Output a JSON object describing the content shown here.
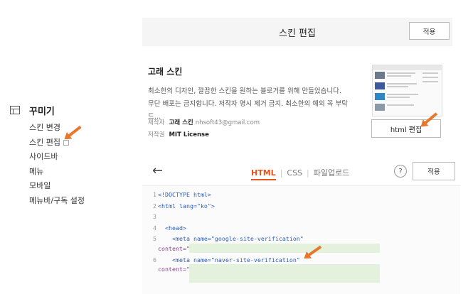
{
  "sidebar": {
    "title": "꾸미기",
    "items": [
      {
        "label": "스킨 변경"
      },
      {
        "label": "스킨 편집"
      },
      {
        "label": "사이드바"
      },
      {
        "label": "메뉴"
      },
      {
        "label": "모바일"
      },
      {
        "label": "메뉴바/구독 설정"
      }
    ]
  },
  "skin_panel": {
    "title": "스킨 편집",
    "apply_label": "적용",
    "skin_name": "고래 스킨",
    "description_line1": "최소한의 디자인, 깔끔한 스킨을 원하는 블로거를 위해 만들었습니다.",
    "description_line2": "무단 배포는 금지합니다. 저작자 명시 제거 금지. 최소한의 예의 꼭 부탁 드…",
    "author_label": "제작자",
    "author_name": "고래 스킨",
    "author_email": "nhsoft43@gmail.com",
    "license_label": "저작권",
    "license_value": "MIT License",
    "html_edit_label": "html 편집"
  },
  "editor": {
    "tabs": [
      {
        "label": "HTML",
        "active": true
      },
      {
        "label": "CSS",
        "active": false
      },
      {
        "label": "파일업로드",
        "active": false
      }
    ],
    "help_label": "?",
    "apply_label": "적용",
    "code_lines": [
      {
        "num": "1",
        "text": "<!DOCTYPE html>"
      },
      {
        "num": "2",
        "text": "<html lang=\"ko\">"
      },
      {
        "num": "3",
        "text": ""
      },
      {
        "num": "4",
        "text": "  <head>"
      },
      {
        "num": "5",
        "text": "    <meta name=\"google-site-verification\""
      },
      {
        "num": "",
        "text": "content=\""
      },
      {
        "num": "6",
        "text": "    <meta name=\"naver-site-verification\""
      },
      {
        "num": "",
        "text": "content=\""
      }
    ]
  },
  "colors": {
    "accent": "#e8541c",
    "arrow": "#e8772e",
    "highlight": "#e3f1dd"
  }
}
